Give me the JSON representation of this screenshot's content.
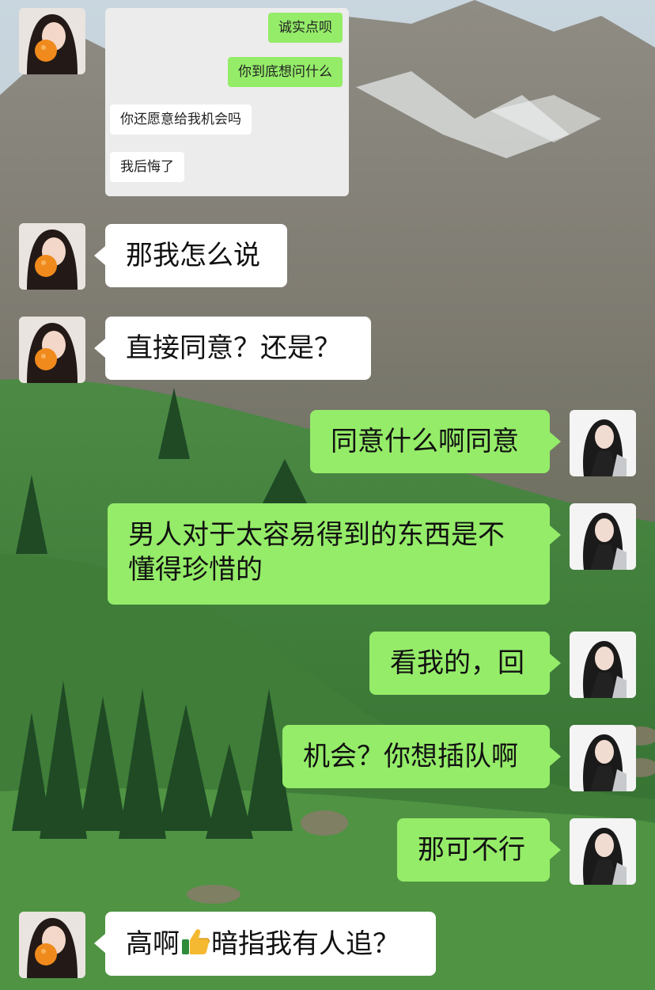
{
  "colors": {
    "outgoing_bubble": "#95ec69",
    "incoming_bubble": "#ffffff",
    "quote_card": "#ececec"
  },
  "quoted_screenshot": {
    "messages": [
      {
        "side": "out",
        "text": "诚实点呗"
      },
      {
        "side": "out",
        "text": "你到底想问什么"
      },
      {
        "side": "in",
        "text": "你还愿意给我机会吗"
      },
      {
        "side": "in",
        "text": "我后悔了"
      }
    ]
  },
  "messages": [
    {
      "side": "in",
      "text": "那我怎么说"
    },
    {
      "side": "in",
      "text": "直接同意？还是？"
    },
    {
      "side": "out",
      "text": "同意什么啊同意"
    },
    {
      "side": "out",
      "text": "男人对于太容易得到的东西是不懂得珍惜的"
    },
    {
      "side": "out",
      "text": "看我的，回"
    },
    {
      "side": "out",
      "text": "机会？你想插队啊"
    },
    {
      "side": "out",
      "text": "那可不行"
    },
    {
      "side": "in",
      "text_before": "高啊",
      "emoji": "thumbs-up-icon",
      "text_after": "暗指我有人追？"
    }
  ]
}
